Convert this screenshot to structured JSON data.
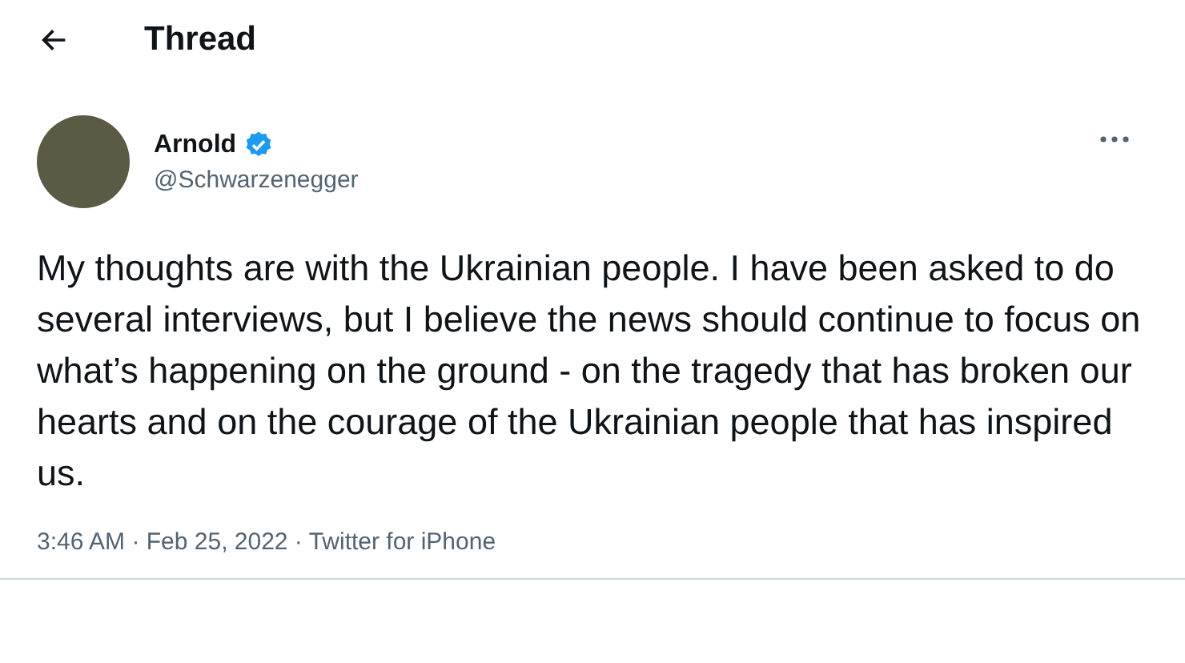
{
  "header": {
    "title": "Thread"
  },
  "tweet": {
    "author": {
      "name": "Arnold",
      "handle": "@Schwarzenegger",
      "verified": true
    },
    "text": "My thoughts are with the Ukrainian people. I have been asked to do several interviews, but I believe the news should continue to focus on what’s happening on the ground - on the tragedy that has broken our hearts and on the courage of the Ukrainian people that has inspired us.",
    "meta": "3:46 AM · Feb 25, 2022 · Twitter for iPhone"
  }
}
